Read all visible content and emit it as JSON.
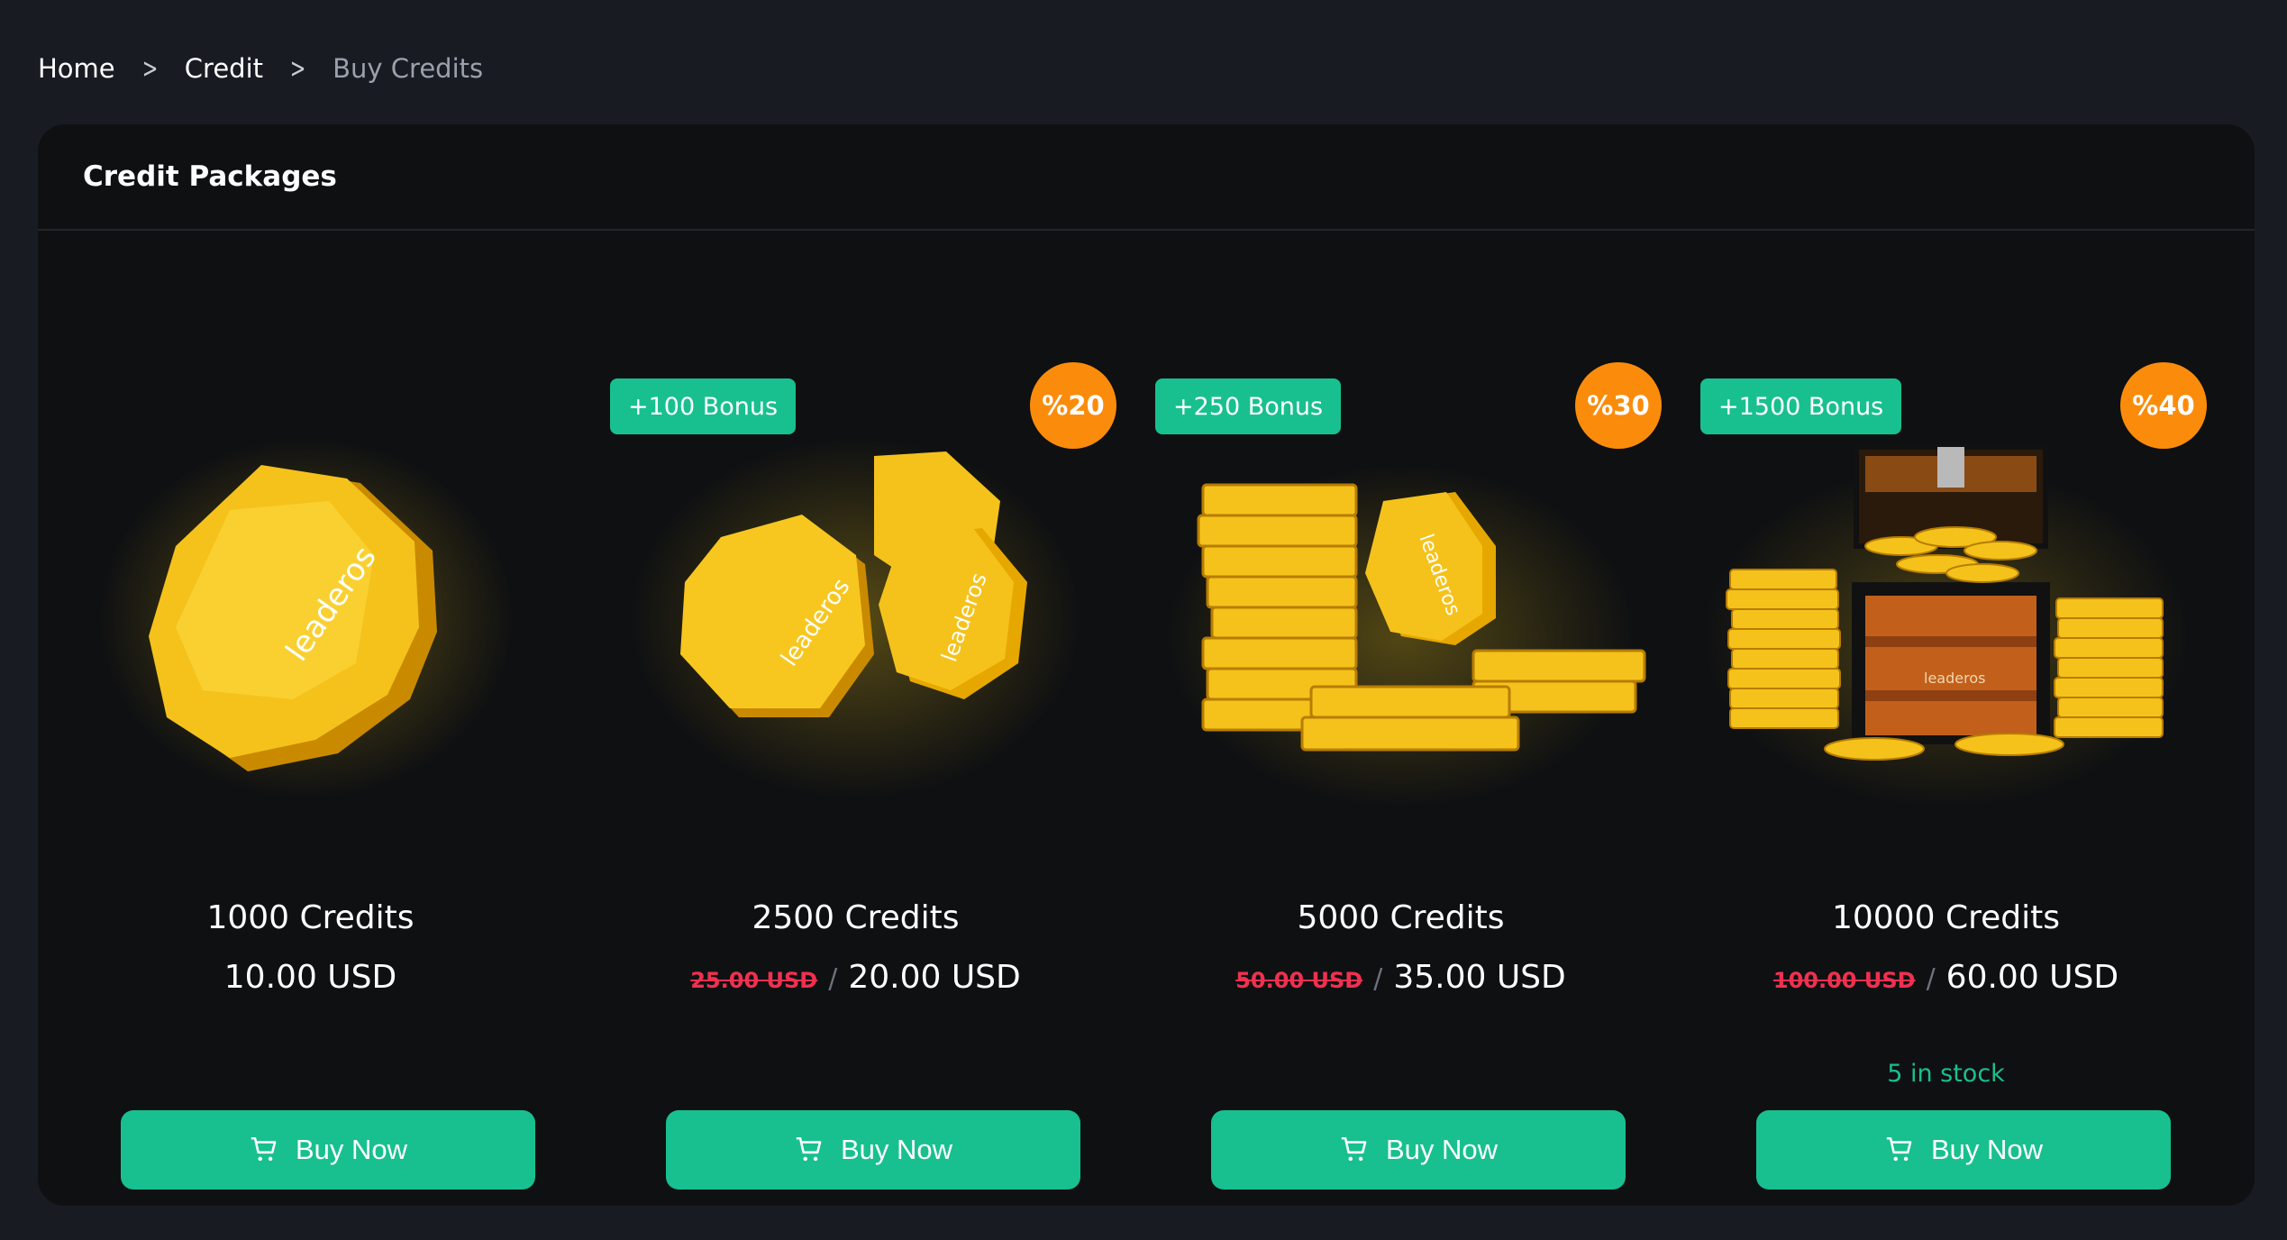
{
  "breadcrumb": {
    "items": [
      "Home",
      "Credit",
      "Buy Credits"
    ]
  },
  "card": {
    "title": "Credit Packages"
  },
  "packages": [
    {
      "name": "1000 Credits",
      "price": "10.00 USD",
      "old_price": "",
      "bonus": "",
      "discount": "",
      "stock": "",
      "button": "Buy Now",
      "image": "single-gold-coin"
    },
    {
      "name": "2500 Credits",
      "price": "20.00 USD",
      "old_price": "25.00 USD",
      "bonus": "+100 Bonus",
      "discount": "%20",
      "stock": "",
      "button": "Buy Now",
      "image": "three-gold-coins"
    },
    {
      "name": "5000 Credits",
      "price": "35.00 USD",
      "old_price": "50.00 USD",
      "bonus": "+250 Bonus",
      "discount": "%30",
      "stock": "",
      "button": "Buy Now",
      "image": "gold-coin-stacks"
    },
    {
      "name": "10000 Credits",
      "price": "60.00 USD",
      "old_price": "100.00 USD",
      "bonus": "+1500 Bonus",
      "discount": "%40",
      "stock": "5 in stock",
      "button": "Buy Now",
      "image": "treasure-chest-with-coins"
    }
  ],
  "logo_text": "leaderos",
  "colors": {
    "accent": "#18c08f",
    "discount": "#fb8c0b",
    "old_price": "#f0304f",
    "background": "#181b22",
    "card": "#0f1012"
  }
}
